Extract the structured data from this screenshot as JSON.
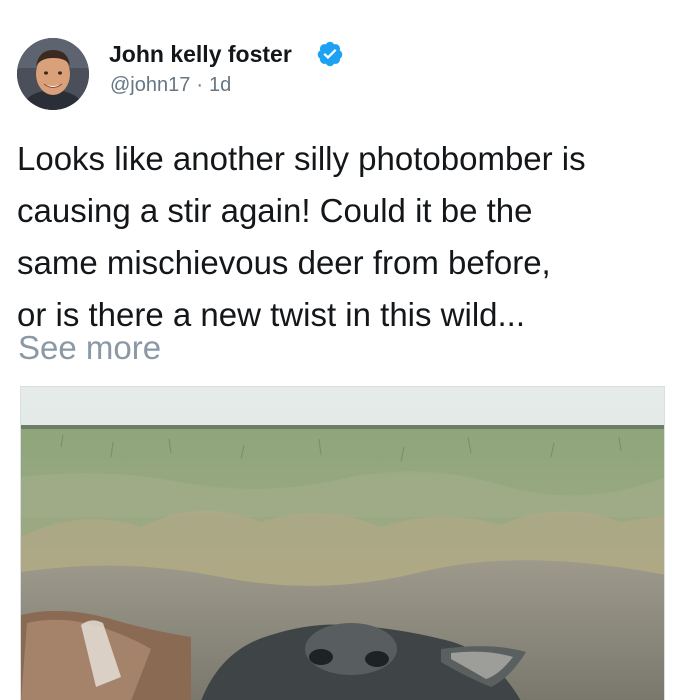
{
  "tweet": {
    "author": {
      "name": "John kelly foster",
      "handle": "@john17",
      "verified_icon": "verified-badge-icon",
      "avatar": "profile-photo"
    },
    "separator": "·",
    "time": "1d",
    "text_lines": [
      "Looks like another silly photobomber is",
      "causing a stir again! Could it be the",
      "same mischievous deer from before,",
      "or is there a new twist in this wild..."
    ],
    "see_more": "See more",
    "media": {
      "kind": "photo",
      "subject": "deer close-up in grassland"
    },
    "colors": {
      "text": "#14171a",
      "secondary": "#657786",
      "see_more": "#8b98a5",
      "verified": "#1da1f2"
    }
  }
}
